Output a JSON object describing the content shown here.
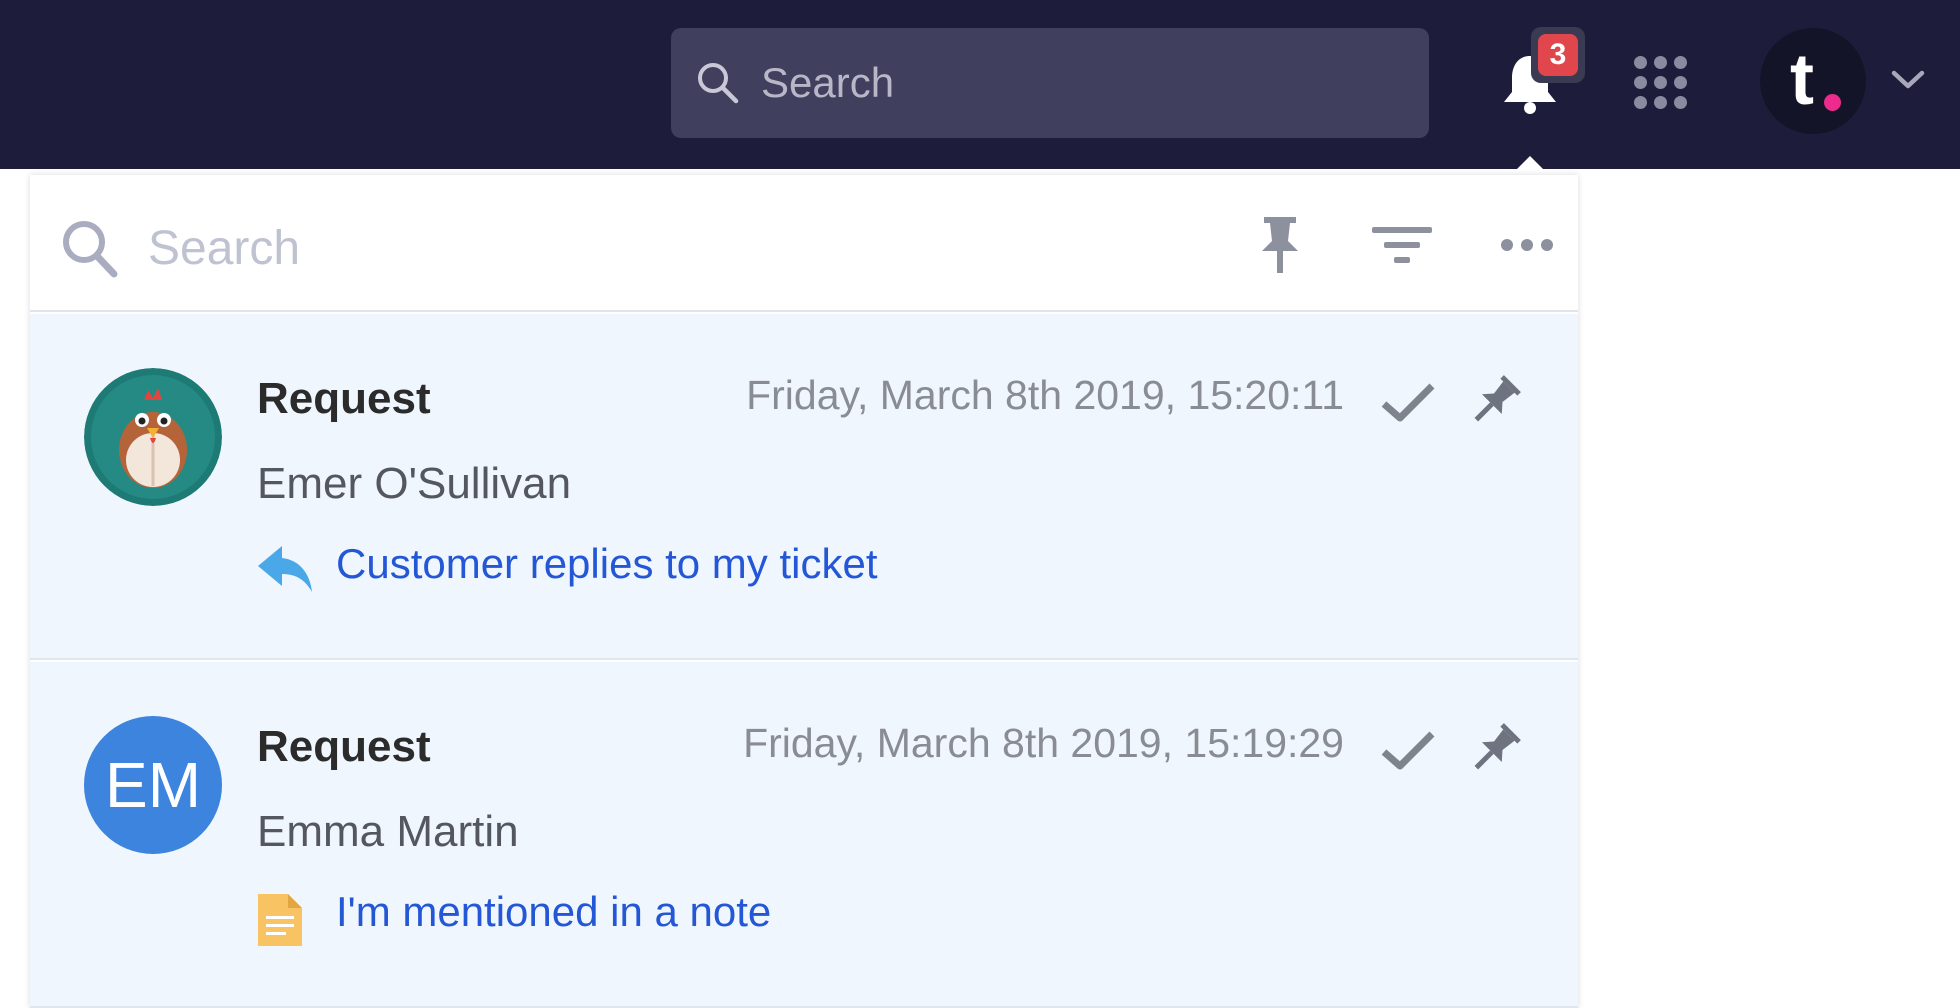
{
  "topbar": {
    "search_placeholder": "Search",
    "notification_count": "3",
    "icons": [
      "search-icon",
      "bell-icon",
      "apps-grid-icon",
      "chevron-down-icon"
    ],
    "logo_letter": "t",
    "colors": {
      "bar": "#1d1d3b",
      "badge": "#e1464c",
      "logo_dot": "#ee2a8c"
    }
  },
  "panel": {
    "search_placeholder": "Search",
    "actions": [
      "pin-icon",
      "filter-icon",
      "more-icon"
    ]
  },
  "notifications": [
    {
      "type": "Request",
      "timestamp": "Friday, March 8th 2019, 15:20:11",
      "person": "Emer O'Sullivan",
      "avatar": "chicken-avatar",
      "event_icon": "reply-icon",
      "event": "Customer replies to my ticket"
    },
    {
      "type": "Request",
      "timestamp": "Friday, March 8th 2019, 15:19:29",
      "person": "Emma Martin",
      "avatar_initials": "EM",
      "event_icon": "note-icon",
      "event": "I'm mentioned in a note"
    }
  ]
}
